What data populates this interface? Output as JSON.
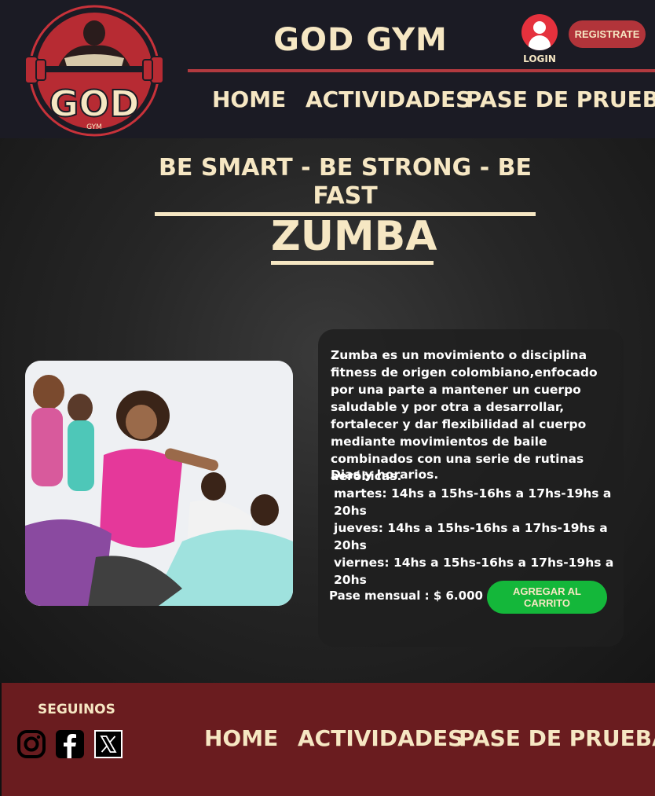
{
  "header": {
    "brand": "GOD GYM",
    "login_label": "LOGIN",
    "register_label": "REGISTRATE",
    "logo_text": "GOD",
    "logo_subtext": "GYM",
    "nav": [
      "HOME",
      "ACTIVIDADES",
      "PASE DE PRUEBA"
    ]
  },
  "main": {
    "tagline": " BE SMART - BE STRONG - BE FAST ",
    "activity_title": "ZUMBA ",
    "description": "Zumba es un movimiento o disciplina fitness de origen colombiano,enfocado por una parte a mantener un cuerpo saludable y por otra a desarrollar, fortalecer y dar flexibilidad al cuerpo mediante movimientos de baile combinados con una serie de rutinas aeróbicas.",
    "schedule_title": "Dias y horarios.",
    "schedule": [
      "martes: 14hs a 15hs-16hs a 17hs-19hs a 20hs",
      "jueves: 14hs a 15hs-16hs a 17hs-19hs a 20hs",
      "viernes: 14hs a 15hs-16hs a 17hs-19hs a 20hs"
    ],
    "price": "Pase mensual : $ 6.000",
    "cart_button": "AGREGAR AL CARRITO"
  },
  "footer": {
    "follow": "SEGUINOS",
    "social": [
      "instagram-icon",
      "facebook-icon",
      "x-icon"
    ],
    "nav": [
      "HOME",
      "ACTIVIDADES",
      "PASE DE PRUEBA"
    ]
  },
  "colors": {
    "cream": "#f6e7c3",
    "header_bg": "#1b1b24",
    "accent_red": "#b2343a",
    "cart_green": "#14b73a",
    "footer_bg": "#6a1c1f"
  }
}
